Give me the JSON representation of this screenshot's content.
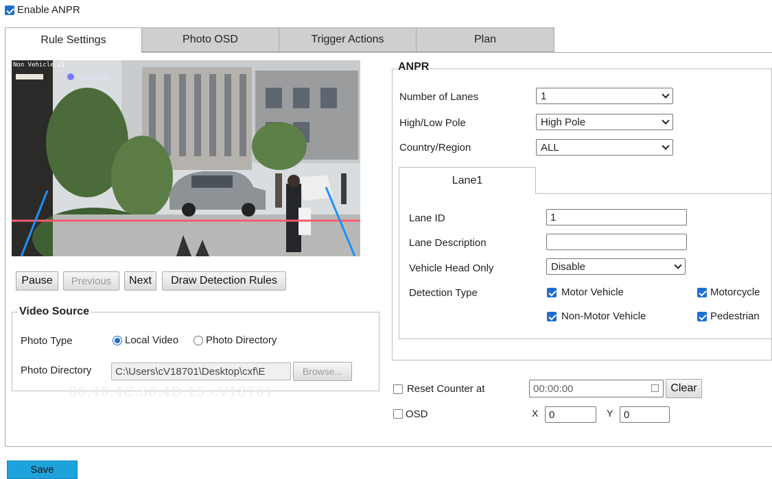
{
  "enable_anpr": {
    "label": "Enable ANPR",
    "checked": true
  },
  "tabs": [
    {
      "label": "Rule Settings",
      "active": true
    },
    {
      "label": "Photo OSD",
      "active": false
    },
    {
      "label": "Trigger Actions",
      "active": false
    },
    {
      "label": "Plan",
      "active": false
    }
  ],
  "video": {
    "overlay_text": "Non Vehicle:22",
    "brand_text": "Apeos-Edu"
  },
  "controls": {
    "pause": "Pause",
    "previous": "Previous",
    "next": "Next",
    "draw_rules": "Draw Detection Rules"
  },
  "video_source": {
    "legend": "Video Source",
    "photo_type_label": "Photo Type",
    "options": [
      "Local Video",
      "Photo Directory"
    ],
    "selected": "Local Video",
    "photo_directory_label": "Photo Directory",
    "photo_directory_value": "C:\\Users\\cV18701\\Desktop\\cxf\\E",
    "browse": "Browse...",
    "watermark": "00:40:4C:30:4D:15:cV18701"
  },
  "anpr": {
    "legend": "ANPR",
    "number_of_lanes": {
      "label": "Number of Lanes",
      "value": "1"
    },
    "pole": {
      "label": "High/Low Pole",
      "value": "High Pole"
    },
    "country": {
      "label": "Country/Region",
      "value": "ALL"
    },
    "lane_tab": "Lane1",
    "lane_id": {
      "label": "Lane ID",
      "value": "1"
    },
    "lane_description": {
      "label": "Lane Description",
      "value": ""
    },
    "vehicle_head_only": {
      "label": "Vehicle Head Only",
      "value": "Disable"
    },
    "detection_type": {
      "label": "Detection Type",
      "items": [
        {
          "label": "Motor Vehicle",
          "checked": true
        },
        {
          "label": "Motorcycle",
          "checked": true
        },
        {
          "label": "Non-Motor Vehicle",
          "checked": true
        },
        {
          "label": "Pedestrian",
          "checked": true
        }
      ]
    }
  },
  "reset_counter": {
    "label": "Reset Counter at",
    "checked": false,
    "time": "00:00:00",
    "clear": "Clear"
  },
  "osd": {
    "label": "OSD",
    "checked": false,
    "x_label": "X",
    "x_value": "0",
    "y_label": "Y",
    "y_value": "0"
  },
  "save": "Save",
  "colors": {
    "accent": "#1d6fd1",
    "save_button": "#1ea2dc",
    "detection_line": "#ff5a6e",
    "lane_line": "#1e90ff"
  }
}
